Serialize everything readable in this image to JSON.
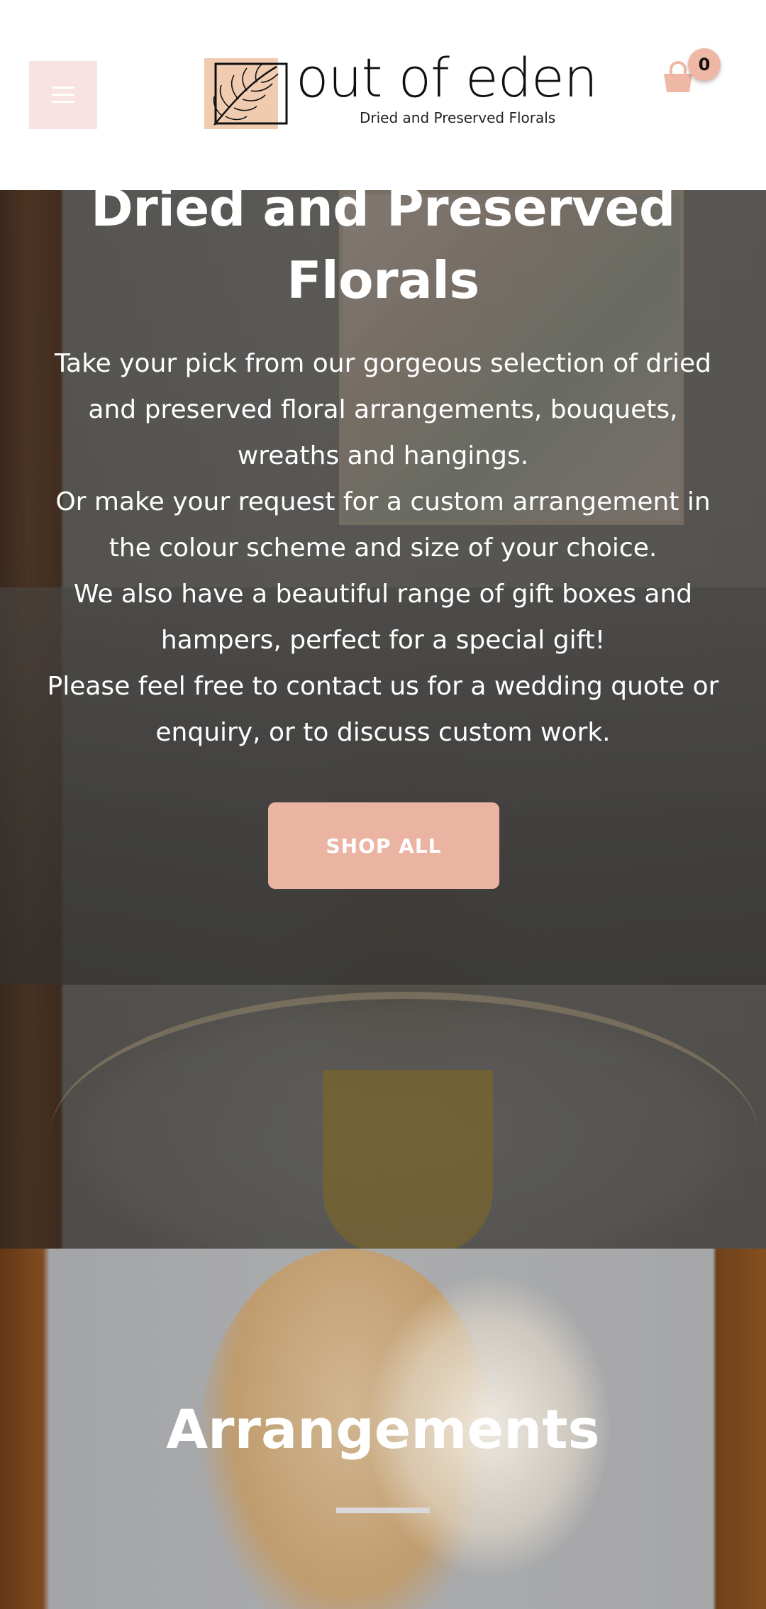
{
  "header": {
    "menu_icon": "hamburger-menu-icon",
    "logo": {
      "name": "out of eden",
      "tagline": "Dried and Preserved Florals"
    },
    "cart": {
      "icon": "shopping-bag-icon",
      "count": "0"
    }
  },
  "hero": {
    "title": "Dried and Preserved Florals",
    "paragraphs": [
      "Take your pick from our gorgeous selection of dried and preserved floral arrangements, bouquets, wreaths and hangings.",
      "Or make your request for a custom arrangement in the colour scheme and size of your choice.",
      "We also have a beautiful range of gift boxes and hampers, perfect for a special gift!",
      "Please feel free to contact us for a wedding quote or enquiry, or to discuss custom work."
    ],
    "button_label": "SHOP ALL"
  },
  "section": {
    "title": "Arrangements"
  },
  "colors": {
    "accent": "#ebb3a2",
    "menu_bg": "#f8e3e2",
    "badge": "#efb7a6"
  }
}
